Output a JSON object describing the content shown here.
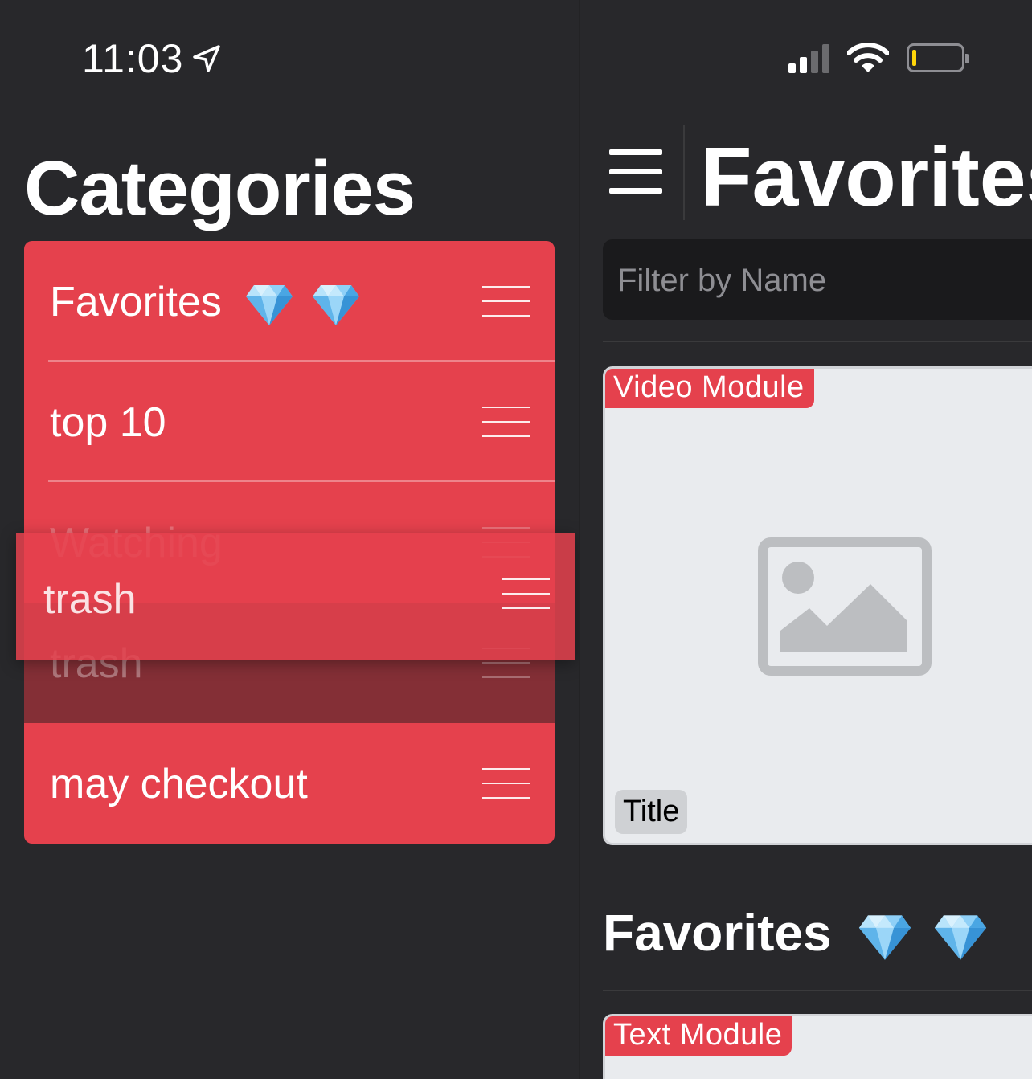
{
  "status_bar": {
    "time": "11:03",
    "location_icon": "location-arrow-icon",
    "signal_icon": "cellular-signal-icon",
    "wifi_icon": "wifi-icon",
    "battery_icon": "battery-low-icon",
    "battery_level": 0.05
  },
  "categories": {
    "title": "Categories",
    "items": [
      {
        "label": "Favorites",
        "gems": 2,
        "state": "normal"
      },
      {
        "label": "top 10",
        "gems": 0,
        "state": "normal"
      },
      {
        "label": "Watching",
        "gems": 0,
        "state": "ghost"
      },
      {
        "label": "trash",
        "gems": 0,
        "state": "placeholder"
      },
      {
        "label": "may checkout",
        "gems": 0,
        "state": "normal"
      }
    ],
    "dragging": {
      "label": "trash"
    },
    "handle_icon": "reorder-handle-icon"
  },
  "detail": {
    "menu_icon": "hamburger-menu-icon",
    "title": "Favorites",
    "filter_placeholder": "Filter by Name",
    "video_card": {
      "badge": "Video Module",
      "image_icon": "image-placeholder-icon",
      "title_chip": "Title"
    },
    "section_title": "Favorites",
    "section_gems": 2,
    "text_card": {
      "badge": "Text Module"
    }
  },
  "colors": {
    "accent": "#e5414d",
    "background": "#28282b",
    "placeholder_row": "#842f36",
    "card": "#e9ebee"
  }
}
